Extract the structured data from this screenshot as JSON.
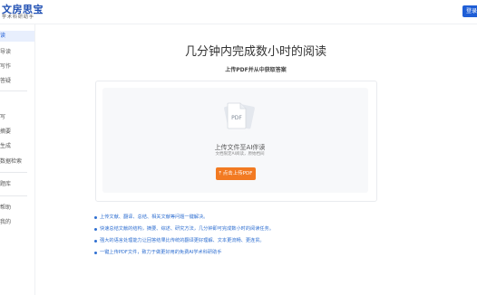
{
  "header": {
    "logo_title": "文房思宝",
    "logo_subtitle": "学术科研助手",
    "login_label": "登录"
  },
  "sidebar": {
    "items": [
      {
        "label": "读"
      },
      {
        "label": "导读"
      },
      {
        "label": "写作"
      },
      {
        "label": "答疑"
      },
      {
        "label": "写"
      },
      {
        "label": "摘要"
      },
      {
        "label": "生成"
      },
      {
        "label": "数据检索"
      },
      {
        "label": "题库"
      },
      {
        "label": "帮助"
      },
      {
        "label": "我的"
      }
    ]
  },
  "main": {
    "title": "几分钟内完成数小时的阅读",
    "subtitle": "上传PDF并从中获取答案"
  },
  "upload": {
    "icon_text": "PDF",
    "label": "上传文件至AI伴读",
    "hint": "文档限定AI阅读，原始档间",
    "button_label": "点击上传PDF",
    "button_icon": "upload-arrow"
  },
  "features": [
    "上传文献、翻译、总结、相关文献等问题一键解决。",
    "快速总结文献的结构，摘要、综述、研究方法，几分钟即可完成数小时的阅读任务。",
    "强大的语言处理能力让回答结果比传统的翻译更好理解、文本更流畅、更连贯。",
    "一键上传PDF文件，致力于做更好用的免费AI学术科研助手"
  ],
  "colors": {
    "accent": "#1f5ed6",
    "button": "#f27a22",
    "feature_text": "#2f6fd1"
  }
}
